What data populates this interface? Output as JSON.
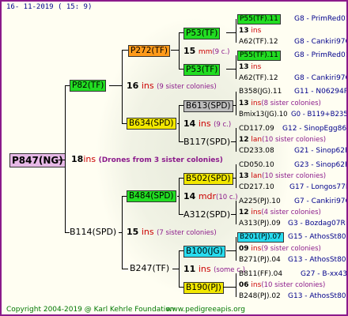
{
  "header": {
    "date": "16- 11-2019 ( 15:  9)"
  },
  "footer": {
    "copyright": "Copyright 2004-2019 @ Karl Kehrle Foundation",
    "site": "www.pedigreeapis.org"
  },
  "root": {
    "label": "P847(NG)",
    "num": "18",
    "ins": "ins",
    "note": "(Drones from 3 sister colonies)"
  },
  "g1": {
    "upper": {
      "label": "P82(TF)",
      "num": "16",
      "ins": "ins",
      "sis": "(9 sister colonies)"
    },
    "lower": {
      "label": "B114(SPD)",
      "num": "15",
      "ins": "ins",
      "sis": "(7 sister colonies)"
    }
  },
  "g2": {
    "a": {
      "label": "P272(TF)",
      "num": "15",
      "ins": "mm",
      "sis": "(9 c.)"
    },
    "b": {
      "label": "B634(SPD)",
      "num": "14",
      "ins": "ins",
      "sis": "(9 c.)"
    },
    "c": {
      "label": "B484(SPD)",
      "num": "14",
      "ins": "mdr",
      "sis": "(10 c.)"
    },
    "d": {
      "label": "B247(TF)",
      "num": "11",
      "ins": "ins",
      "sis": "(some c.)"
    }
  },
  "g3": [
    {
      "label": "P53(TF)",
      "num": "13",
      "ins": "ins",
      "top": "P55(TF).11",
      "topr": "G8 - PrimRed01",
      "bot": "A62(TF).12",
      "botr": "G8 - Cankiri97Q"
    },
    {
      "label": "P53(TF)",
      "num": "13",
      "ins": "ins",
      "top": "P55(TF).11",
      "topr": "G8 - PrimRed01",
      "bot": "A62(TF).12",
      "botr": "G8 - Cankiri97Q"
    },
    {
      "label": "B613(SPD)",
      "num": "13",
      "ins": "ins",
      "sis": "(8 sister colonies)",
      "top": "B358(JG).11",
      "topr": "G11 - N06294R",
      "bot": "Bmix13(JG).10",
      "botr": "G0 - B119+B235+B"
    },
    {
      "label": "B117(SPD)",
      "num": "12",
      "ins": "lan",
      "sis": "(10 sister colonies)",
      "top": "CD117.09",
      "topr": "G12 - SinopEgg86R",
      "bot": "CD233.08",
      "botr": "G21 - Sinop62R"
    },
    {
      "label": "B502(SPD)",
      "num": "13",
      "ins": "lan",
      "sis": "(10 sister colonies)",
      "top": "CD050.10",
      "topr": "G23 - Sinop62R",
      "bot": "CD217.10",
      "botr": "G17 - Longos77R"
    },
    {
      "label": "A312(SPD)",
      "num": "12",
      "ins": "ins",
      "sis": "(4 sister colonies)",
      "top": "A225(PJ).10",
      "topr": "G7 - Cankiri97Q",
      "bot": "A313(PJ).09",
      "botr": "G3 - Bozdag07R"
    },
    {
      "label": "B100(JG)",
      "num": "09",
      "ins": "ins",
      "sis": "(9 sister colonies)",
      "top": "B201(PJ).07",
      "topr": "G15 - AthosSt80R",
      "bot": "B271(PJ).04",
      "botr": "G13 - AthosSt80R"
    },
    {
      "label": "B190(PJ)",
      "num": "06",
      "ins": "ins",
      "sis": "(10 sister colonies)",
      "top": "B811(FF).04",
      "topr": "G27 - B-xx43",
      "bot": "B248(PJ).02",
      "botr": "G13 - AthosSt80R"
    }
  ],
  "colors": {
    "frame": "#8b1a8b",
    "green": "#22dd22",
    "orange": "#ff9a1a",
    "yellow": "#f2e800",
    "cyan": "#28dcef",
    "gray": "#bdbdbd"
  }
}
